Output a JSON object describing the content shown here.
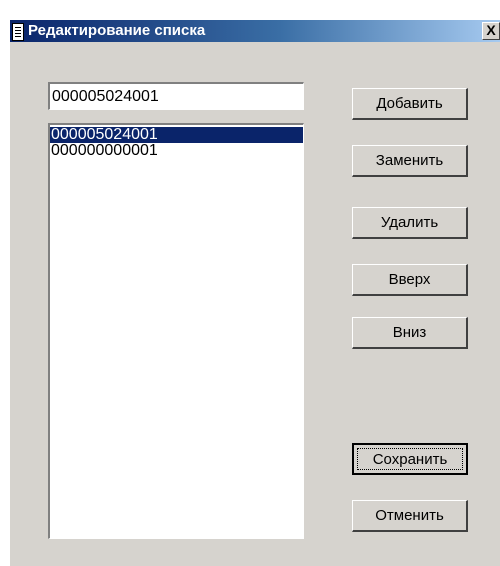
{
  "window": {
    "title": "Редактирование списка",
    "close_label": "X"
  },
  "edit": {
    "value": "000005024001"
  },
  "list": {
    "items": [
      "000005024001",
      "000000000001"
    ],
    "selected_index": 0
  },
  "buttons": {
    "add": "Добавить",
    "replace": "Заменить",
    "delete": "Удалить",
    "up": "Вверх",
    "down": "Вниз",
    "save": "Сохранить",
    "cancel": "Отменить"
  },
  "colors": {
    "title_active": "#0a246a",
    "selection": "#0a246a",
    "face": "#d6d3ce"
  }
}
